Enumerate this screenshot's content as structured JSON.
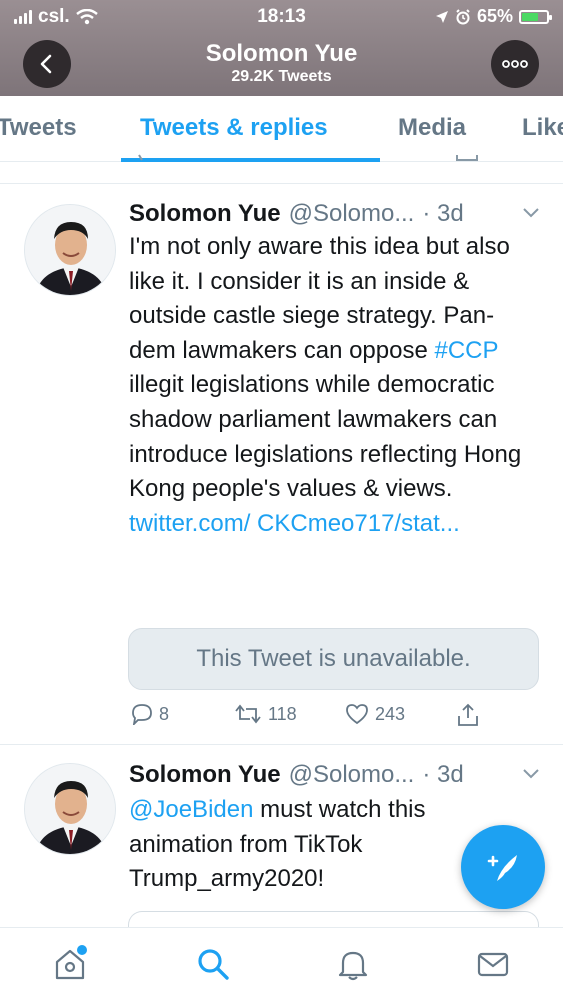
{
  "status_bar": {
    "carrier": "csl.",
    "time": "18:13",
    "battery": "65%"
  },
  "header": {
    "title": "Solomon Yue",
    "subtitle": "29.2K Tweets"
  },
  "tabs": [
    {
      "label": "Tweets"
    },
    {
      "label": "Tweets & replies"
    },
    {
      "label": "Media"
    },
    {
      "label": "Likes"
    }
  ],
  "tweets": [
    {
      "name": "Solomon Yue",
      "handle": "@Solomo...",
      "time": "· 3d",
      "text_parts": [
        "I'm not only aware this idea but also like it. I consider it is an inside & outside castle siege strategy. Pan-dem lawmakers can oppose ",
        "#CCP",
        " illegit legislations while democratic shadow parliament lawmakers can introduce legislations reflecting Hong Kong people's values & views. ",
        "twitter.com/ CKCmeo717/stat..."
      ],
      "quote": "This Tweet is unavailable.",
      "replies": "8",
      "retweets": "118",
      "likes": "243"
    },
    {
      "name": "Solomon Yue",
      "handle": "@Solomo...",
      "time": "· 3d",
      "text_parts": [
        "@JoeBiden",
        " must watch this animation from TikTok Trump_army2020!"
      ]
    }
  ],
  "icons": {
    "back": "chevron-left-icon",
    "more": "more-icon",
    "compose": "compose-tweet-icon",
    "nav": [
      "home-icon",
      "search-icon",
      "notifications-icon",
      "messages-icon"
    ]
  },
  "colors": {
    "accent": "#1da1f2",
    "muted": "#657786",
    "text": "#14171a"
  }
}
